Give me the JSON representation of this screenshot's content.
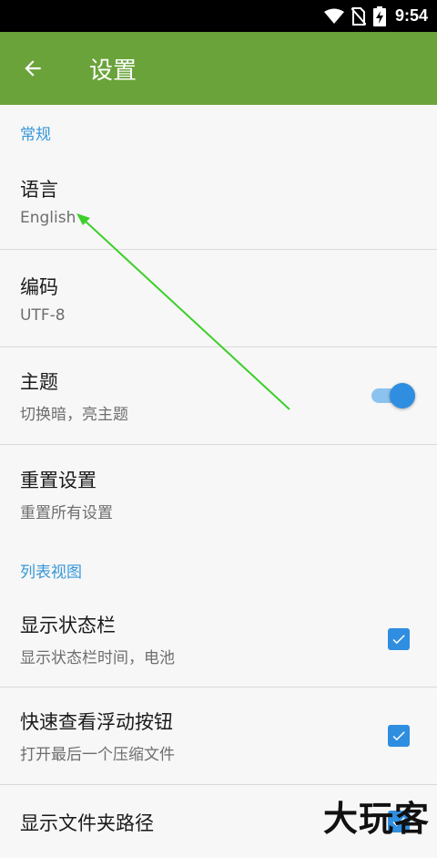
{
  "status_bar": {
    "time": "9:54",
    "icons": [
      "wifi-icon",
      "no-sim-icon",
      "battery-charging-icon"
    ]
  },
  "app_bar": {
    "back_icon": "arrow-left-icon",
    "title": "设置"
  },
  "sections": [
    {
      "header": "常规",
      "items": [
        {
          "title": "语言",
          "summary": "English"
        },
        {
          "title": "编码",
          "summary": "UTF-8"
        },
        {
          "title": "主题",
          "summary": "切换暗，亮主题",
          "control": "switch",
          "checked": true
        },
        {
          "title": "重置设置",
          "summary": "重置所有设置"
        }
      ]
    },
    {
      "header": "列表视图",
      "items": [
        {
          "title": "显示状态栏",
          "summary": "显示状态栏时间，电池",
          "control": "checkbox",
          "checked": true
        },
        {
          "title": "快速查看浮动按钮",
          "summary": "打开最后一个压缩文件",
          "control": "checkbox",
          "checked": true
        },
        {
          "title": "显示文件夹路径",
          "control": "checkbox",
          "checked": true
        }
      ]
    }
  ],
  "colors": {
    "app_bar": "#6aa33a",
    "accent": "#2f8ee0",
    "section_header": "#3897d8",
    "annotation_arrow": "#3ccf2a"
  },
  "watermark": "大玩客"
}
